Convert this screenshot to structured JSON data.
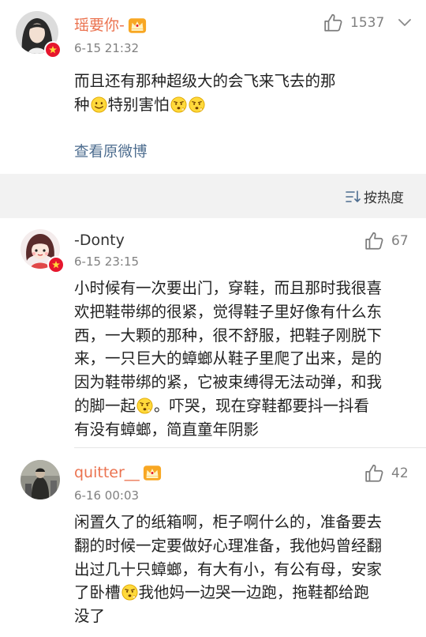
{
  "comments": [
    {
      "user": "瑶要你-",
      "time": "6-15 21:32",
      "likes": "1537",
      "text_a": "而且还有那种超级大的会飞来飞去的那",
      "text_b1": "种",
      "text_b2": "特别害怕",
      "link": "查看原微博"
    },
    {
      "user": "-Donty",
      "time": "6-15 23:15",
      "likes": "67",
      "lines": [
        "小时候有一次要出门，穿鞋，而且那时我很喜",
        "欢把鞋带绑的很紧，觉得鞋子里好像有什么东",
        "西，一大颗的那种，很不舒服，把鞋子刚脱下",
        "来，一只巨大的蟑螂从鞋子里爬了出来，是的",
        "因为鞋带绑的紧，它被束缚得无法动弹，和我"
      ],
      "line6a": "的脚一起",
      "line6b": "。吓哭，现在穿鞋都要抖一抖看",
      "line7": "有没有蟑螂，简直童年阴影"
    },
    {
      "user": "quitter__",
      "time": "6-16 00:03",
      "likes": "42",
      "lines": [
        "闲置久了的纸箱啊，柜子啊什么的，准备要去",
        "翻的时候一定要做好心理准备，我他妈曾经翻",
        "出过几十只蟑螂，有大有小，有公有母，安家"
      ],
      "line4a": "了卧槽",
      "line4b": "我他妈一边哭一边跑，拖鞋都给跑",
      "line5": "没了"
    }
  ],
  "sort_label": "按热度",
  "icons": {
    "thumb": "thumbs-up-icon",
    "more": "more-icon",
    "sort": "sort-icon",
    "vip": "vip-crown-icon",
    "badge": "verified-badge-icon",
    "emoji_smile": "smile-emoji",
    "emoji_worried": "worried-emoji"
  },
  "colors": {
    "vip_name": "#eb7350",
    "link": "#4d6d8f",
    "badge": "#e6162d"
  }
}
